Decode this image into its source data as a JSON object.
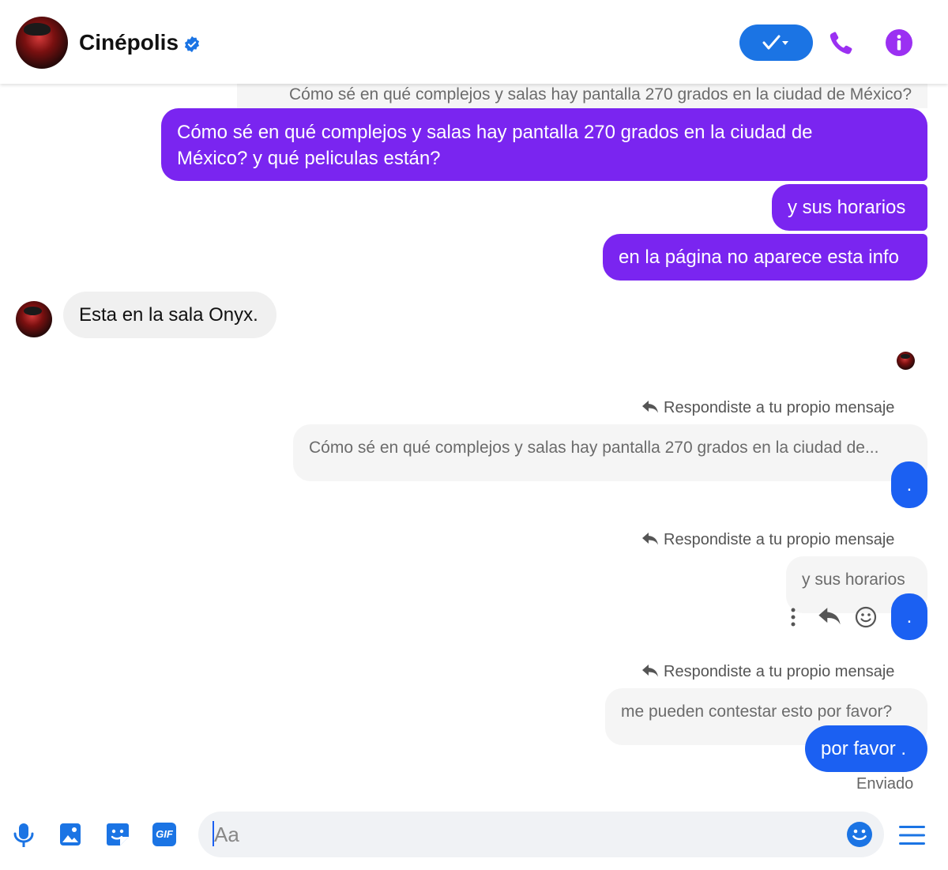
{
  "header": {
    "contact_name": "Cinépolis",
    "verified_icon": "verified-badge-icon",
    "status_button_icon": "check-dropdown-icon",
    "call_icon": "phone-icon",
    "info_icon": "info-icon"
  },
  "messages": {
    "top_quoted": "Cómo sé en qué complejos y salas hay pantalla 270 grados en la ciudad de México?",
    "out_1_line1": "Cómo sé en qué complejos y salas hay pantalla 270 grados en la ciudad de",
    "out_1_line2": "México? y qué peliculas están?",
    "out_2": "y sus horarios",
    "out_3": "en la página no aparece esta info",
    "in_1": "Esta en la sala Onyx.",
    "reply_1_label": "Respondiste a tu propio mensaje",
    "reply_1_quoted": "Cómo sé en qué complejos y salas hay pantalla 270 grados en la ciudad de...",
    "reply_1_text": ".",
    "reply_2_label": "Respondiste a tu propio mensaje",
    "reply_2_quoted": "y sus horarios",
    "reply_2_text": ".",
    "reply_3_label": "Respondiste a tu propio mensaje",
    "reply_3_quoted": "me pueden contestar esto por favor?",
    "reply_3_text": "por favor .",
    "status": "Enviado"
  },
  "composer": {
    "placeholder": "Aa",
    "icons": [
      "microphone-icon",
      "image-icon",
      "sticker-icon",
      "gif-icon",
      "emoji-icon",
      "menu-icon"
    ],
    "gif_label": "GIF"
  },
  "colors": {
    "outgoing_purple": "#7a25f0",
    "outgoing_blue": "#1b60f2",
    "incoming_gray": "#f0f0f0",
    "accent_blue": "#1b74e4",
    "icon_purple": "#9b30f2"
  }
}
